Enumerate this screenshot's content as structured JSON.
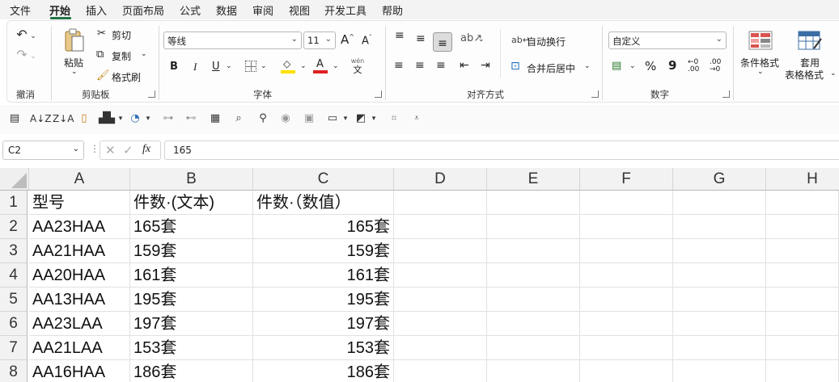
{
  "menu_tabs": [
    "文件",
    "开始",
    "插入",
    "页面布局",
    "公式",
    "数据",
    "审阅",
    "视图",
    "开发工具",
    "帮助"
  ],
  "ribbon": {
    "undo_group": {
      "label": "撤消"
    },
    "clipboard": {
      "label": "剪贴板",
      "paste": "粘贴",
      "cut": "剪切",
      "copy": "复制",
      "format_painter": "格式刷"
    },
    "font": {
      "label": "字体",
      "name": "等线",
      "size": "11",
      "bold": "B",
      "italic": "I",
      "underline": "U",
      "grow": "A",
      "shrink": "A",
      "phonetic_top": "wén",
      "phonetic_bottom": "文"
    },
    "alignment": {
      "label": "对齐方式",
      "wrap_text": "自动换行",
      "merge_center": "合并后居中"
    },
    "number": {
      "label": "数字",
      "format": "自定义",
      "percent": "%",
      "comma": "9",
      "inc_decimal": ".00",
      "dec_decimal": ".00"
    },
    "styles": {
      "conditional_format": "条件格式",
      "table_format_l1": "套用",
      "table_format_l2": "表格格式"
    }
  },
  "formula_bar": {
    "name_box": "C2",
    "fx": "fx",
    "content": "165"
  },
  "columns": [
    "A",
    "B",
    "C",
    "D",
    "E",
    "F",
    "G",
    "H"
  ],
  "rows": [
    {
      "num": "1",
      "a": "型号",
      "b": "件数·(文本)",
      "c": "件数·（数值）"
    },
    {
      "num": "2",
      "a": "AA23HAA",
      "b": "165套",
      "c": "165套"
    },
    {
      "num": "3",
      "a": "AA21HAA",
      "b": "159套",
      "c": "159套"
    },
    {
      "num": "4",
      "a": "AA20HAA",
      "b": "161套",
      "c": "161套"
    },
    {
      "num": "5",
      "a": "AA13HAA",
      "b": "195套",
      "c": "195套"
    },
    {
      "num": "6",
      "a": "AA23LAA",
      "b": "197套",
      "c": "197套"
    },
    {
      "num": "7",
      "a": "AA21LAA",
      "b": "153套",
      "c": "153套"
    },
    {
      "num": "8",
      "a": "AA16HAA",
      "b": "186套",
      "c": "186套"
    }
  ],
  "colors": {
    "accent": "#217346",
    "font_color": "#e02020",
    "highlight": "#ffe000"
  }
}
